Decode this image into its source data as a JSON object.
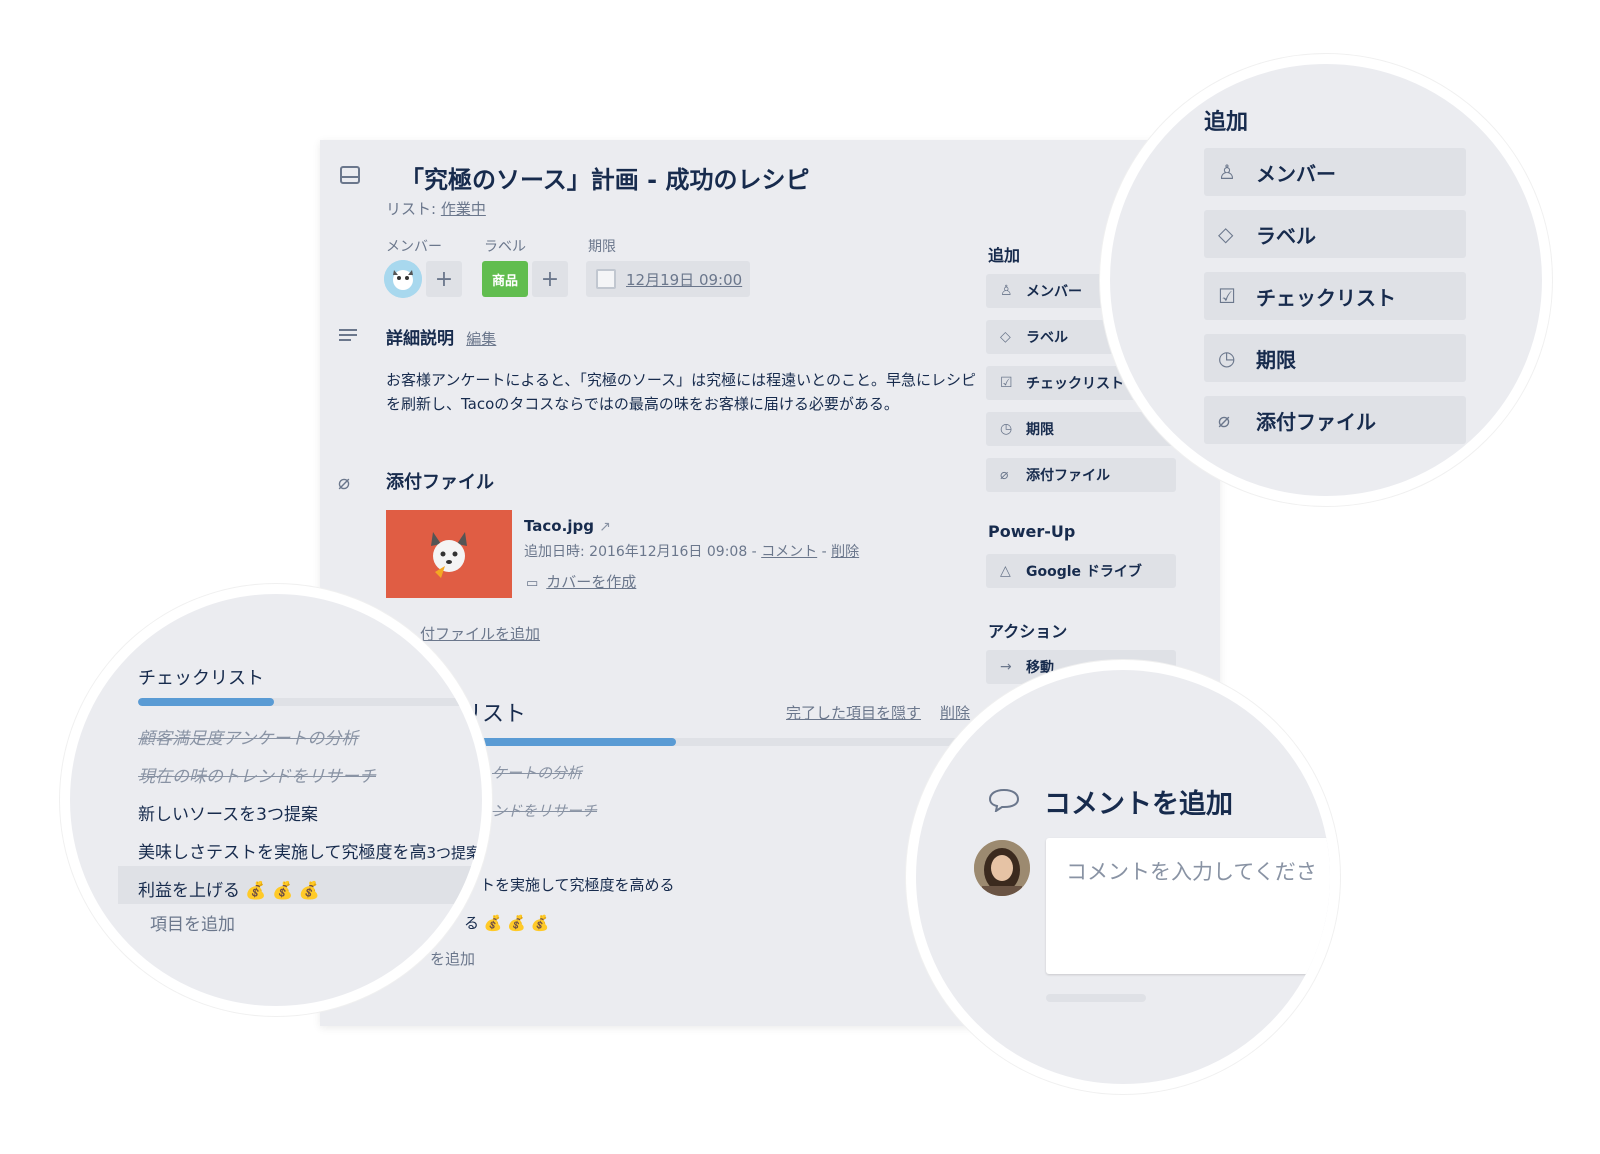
{
  "card": {
    "title": "「究極のソース」計画 - 成功のレシピ",
    "list_prefix": "リスト: ",
    "list_name": "作業中",
    "members_label": "メンバー",
    "labels_label": "ラベル",
    "due_label": "期限",
    "label_tag": "商品",
    "plus": "+",
    "due_date": "12月19日 09:00",
    "desc_title": "詳細説明",
    "desc_edit": "編集",
    "description": "お客様アンケートによると、「究極のソース」は究極には程遠いとのこと。早急にレシピを刷新し、Tacoのタコスならではの最高の味をお客様に届ける必要がある。",
    "attach_title": "添付ファイル",
    "file_name": "Taco.jpg",
    "file_meta": "追加日時: 2016年12月16日 09:08 - ",
    "file_comment": "コメント",
    "file_sep": " - ",
    "file_delete": "削除",
    "make_cover": "カバーを作成",
    "add_attachment": "付ファイルを追加",
    "checklist_title_partial": "リスト",
    "hide_done": "完了した項目を隠す",
    "delete": "削除",
    "partial_items": [
      "ケートの分析",
      "ンドをリサーチ",
      "トを実施して究極度を高める",
      "る 💰 💰 💰",
      "を追加"
    ]
  },
  "sidebar": {
    "add_title": "追加",
    "add_buttons": [
      "メンバー",
      "ラベル",
      "チェックリスト",
      "期限",
      "添付ファイル"
    ],
    "powerup_title": "Power-Up",
    "powerup_button": "Google ドライブ",
    "actions_title": "アクション",
    "move_button": "移動"
  },
  "zoom_add": {
    "title": "追加",
    "buttons": [
      "メンバー",
      "ラベル",
      "チェックリスト",
      "期限",
      "添付ファイル"
    ]
  },
  "zoom_checklist": {
    "title": "チェックリスト",
    "progress_fraction": 0.4,
    "items": [
      {
        "text": "顧客満足度アンケートの分析",
        "done": true
      },
      {
        "text": "現在の味のトレンドをリサーチ",
        "done": true
      },
      {
        "text": "新しいソースを3つ提案",
        "done": false
      },
      {
        "text": "美味しさテストを実施して究極度を高",
        "done": false
      },
      {
        "text": "利益を上げる 💰 💰 💰",
        "done": false
      }
    ],
    "partial_overlap": "3つ提案",
    "add_item_partial": "項目を追加"
  },
  "zoom_comment": {
    "title": "コメントを追加",
    "placeholder": "コメントを入力してくださ"
  },
  "colors": {
    "label_green": "#61bd4f",
    "progress_blue": "#5a9bd4",
    "attachment_bg": "#e05d44"
  }
}
